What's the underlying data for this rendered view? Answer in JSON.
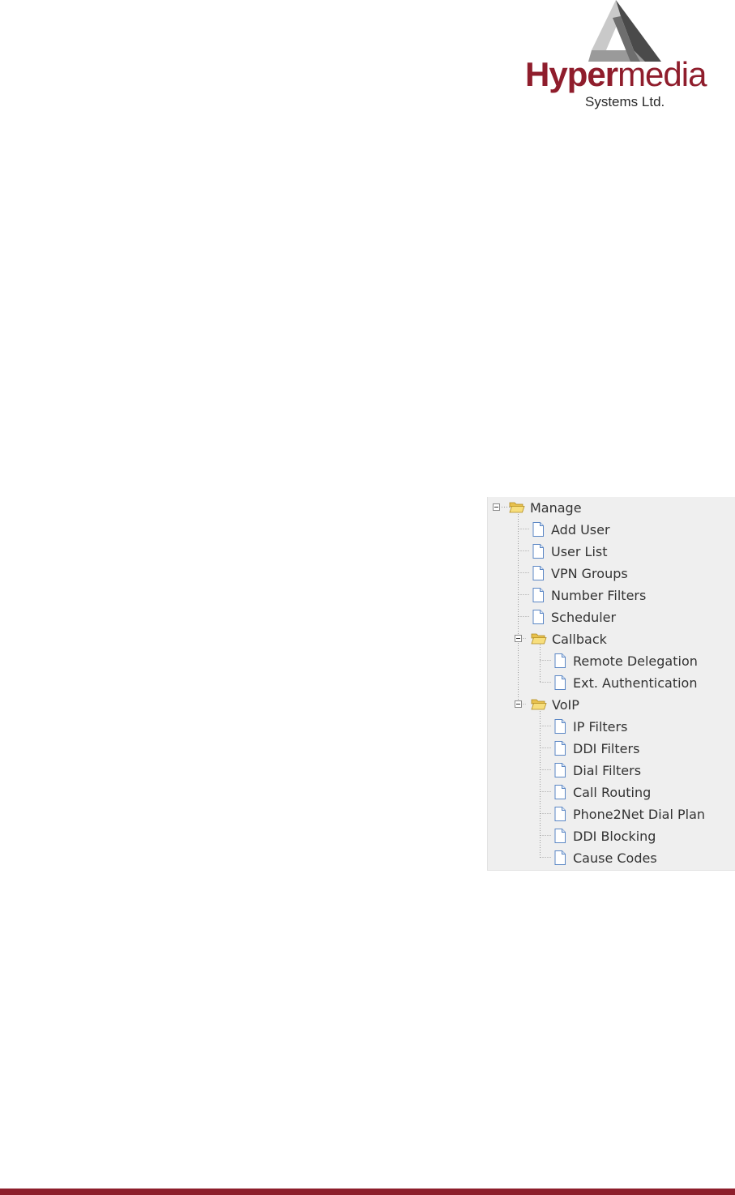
{
  "logo": {
    "word_bold": "Hyper",
    "word_light": "media",
    "subtitle": "Systems Ltd.",
    "icon": "triangle-logo-icon",
    "brand_color": "#8f1d2c"
  },
  "tree": {
    "root": {
      "label": "Manage",
      "icon": "open-folder-icon"
    },
    "items": {
      "add_user": "Add User",
      "user_list": "User List",
      "vpn_groups": "VPN Groups",
      "number_filters": "Number Filters",
      "scheduler": "Scheduler"
    },
    "callback": {
      "label": "Callback",
      "items": {
        "remote_delegation": "Remote Delegation",
        "ext_authentication": "Ext. Authentication"
      }
    },
    "voip": {
      "label": "VoIP",
      "items": {
        "ip_filters": "IP Filters",
        "ddi_filters": "DDI Filters",
        "dial_filters": "Dial Filters",
        "call_routing": "Call Routing",
        "phone2net": "Phone2Net Dial Plan",
        "ddi_blocking": "DDI Blocking",
        "cause_codes": "Cause Codes"
      }
    }
  },
  "colors": {
    "panel_bg": "#efefef",
    "text": "#333333",
    "footer_bar": "#8d1e2b",
    "folder": "#f4d46c"
  }
}
